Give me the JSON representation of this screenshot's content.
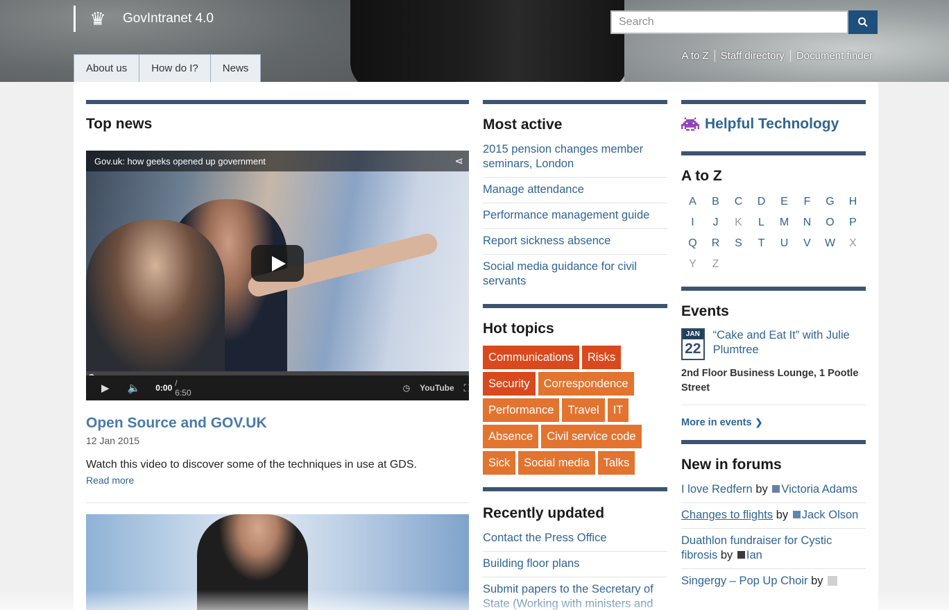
{
  "header": {
    "site_title": "GovIntranet 4.0",
    "search_placeholder": "Search",
    "utility_links": [
      "A to Z",
      "Staff directory",
      "Document finder"
    ],
    "tabs": [
      "About us",
      "How do I?",
      "News"
    ]
  },
  "top_news": {
    "heading": "Top news",
    "video": {
      "title": "Gov.uk: how geeks opened up government",
      "current_time": "0:00",
      "duration": "/ 6:50",
      "brand": "YouTube"
    },
    "article": {
      "title": "Open Source and GOV.UK",
      "date": "12 Jan 2015",
      "summary": "Watch this video to discover some of the techniques in use at GDS.",
      "read_more": "Read more"
    }
  },
  "most_active": {
    "heading": "Most active",
    "items": [
      "2015 pension changes member seminars, London",
      "Manage attendance",
      "Performance management guide",
      "Report sickness absence",
      "Social media guidance for civil servants"
    ]
  },
  "hot_topics": {
    "heading": "Hot topics",
    "tags": [
      {
        "label": "Communications",
        "color": "#d9491d"
      },
      {
        "label": "Risks",
        "color": "#d9491d"
      },
      {
        "label": "Security",
        "color": "#d9491d"
      },
      {
        "label": "Correspondence",
        "color": "#e27430"
      },
      {
        "label": "Performance",
        "color": "#e27430"
      },
      {
        "label": "Travel",
        "color": "#e27430"
      },
      {
        "label": "IT",
        "color": "#e27430"
      },
      {
        "label": "Absence",
        "color": "#e27430"
      },
      {
        "label": "Civil service code",
        "color": "#e27430"
      },
      {
        "label": "Sick",
        "color": "#e27430"
      },
      {
        "label": "Social media",
        "color": "#e27430"
      },
      {
        "label": "Talks",
        "color": "#e27430"
      }
    ]
  },
  "recently_updated": {
    "heading": "Recently updated",
    "items": [
      "Contact the Press Office",
      "Building floor plans",
      "Submit papers to the Secretary of State (Working with ministers and"
    ]
  },
  "helpful": {
    "label": "Helpful Technology",
    "icon_color": "#8e3fb6"
  },
  "a_to_z": {
    "heading": "A to Z",
    "letters": [
      {
        "l": "A",
        "active": true
      },
      {
        "l": "B",
        "active": true
      },
      {
        "l": "C",
        "active": true
      },
      {
        "l": "D",
        "active": true
      },
      {
        "l": "E",
        "active": true
      },
      {
        "l": "F",
        "active": true
      },
      {
        "l": "G",
        "active": true
      },
      {
        "l": "H",
        "active": true
      },
      {
        "l": "I",
        "active": true
      },
      {
        "l": "J",
        "active": true
      },
      {
        "l": "K",
        "active": false
      },
      {
        "l": "L",
        "active": true
      },
      {
        "l": "M",
        "active": true
      },
      {
        "l": "N",
        "active": true
      },
      {
        "l": "O",
        "active": true
      },
      {
        "l": "P",
        "active": true
      },
      {
        "l": "Q",
        "active": true
      },
      {
        "l": "R",
        "active": true
      },
      {
        "l": "S",
        "active": true
      },
      {
        "l": "T",
        "active": true
      },
      {
        "l": "U",
        "active": true
      },
      {
        "l": "V",
        "active": true
      },
      {
        "l": "W",
        "active": true
      },
      {
        "l": "X",
        "active": false
      },
      {
        "l": "Y",
        "active": false
      },
      {
        "l": "Z",
        "active": false
      }
    ]
  },
  "events": {
    "heading": "Events",
    "item": {
      "month": "JAN",
      "day": "22",
      "title": "“Cake and Eat It” with Julie Plumtree",
      "location": "2nd Floor Business Lounge, 1 Pootle Street"
    },
    "more_label": "More in events"
  },
  "forums": {
    "heading": "New in forums",
    "items": [
      {
        "topic": "I love Redfern",
        "by": "by",
        "user": "Victoria Adams"
      },
      {
        "topic": "Changes to flights",
        "by": "by",
        "user": "Jack Olson"
      },
      {
        "topic": "Duathlon fundraiser for Cystic fibrosis",
        "by": "by",
        "user": "Ian"
      },
      {
        "topic": "Singergy – Pop Up Choir",
        "by": "by",
        "user": ""
      }
    ]
  }
}
